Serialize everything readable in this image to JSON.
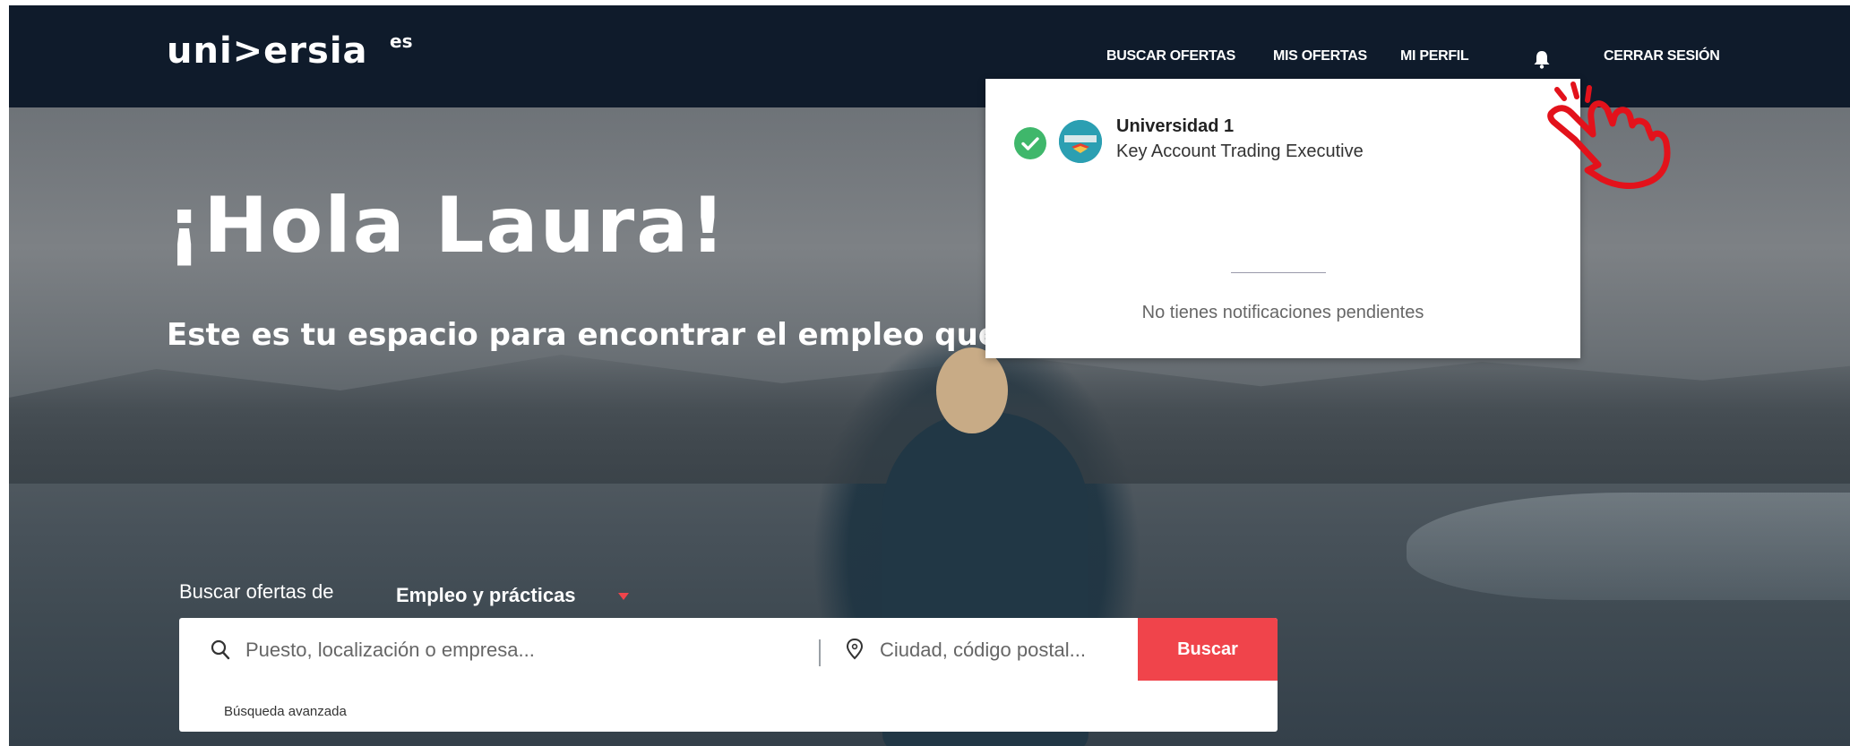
{
  "brand": {
    "logo_text": "uni>ersia",
    "region": "es"
  },
  "nav": {
    "items": [
      "BUSCAR OFERTAS",
      "MIS OFERTAS",
      "MI PERFIL"
    ],
    "logout": "CERRAR SESIÓN",
    "bell_icon": "bell-icon"
  },
  "hero": {
    "greeting": "¡Hola Laura!",
    "subtitle": "Este es tu espacio para encontrar el empleo que"
  },
  "search": {
    "label": "Buscar ofertas de",
    "mode": "Empleo y prácticas",
    "query_placeholder": "Puesto, localización o empresa...",
    "location_placeholder": "Ciudad, código postal...",
    "button": "Buscar",
    "advanced": "Búsqueda avanzada"
  },
  "notifications": {
    "items": [
      {
        "title": "Universidad 1",
        "subtitle": "Key Account Trading Executive",
        "status_icon": "check-icon"
      }
    ],
    "empty_message": "No tienes notificaciones pendientes"
  },
  "colors": {
    "header_bg": "#0f1b2b",
    "accent": "#f0444b",
    "success": "#3fb76b",
    "annotation": "#e3121b"
  }
}
